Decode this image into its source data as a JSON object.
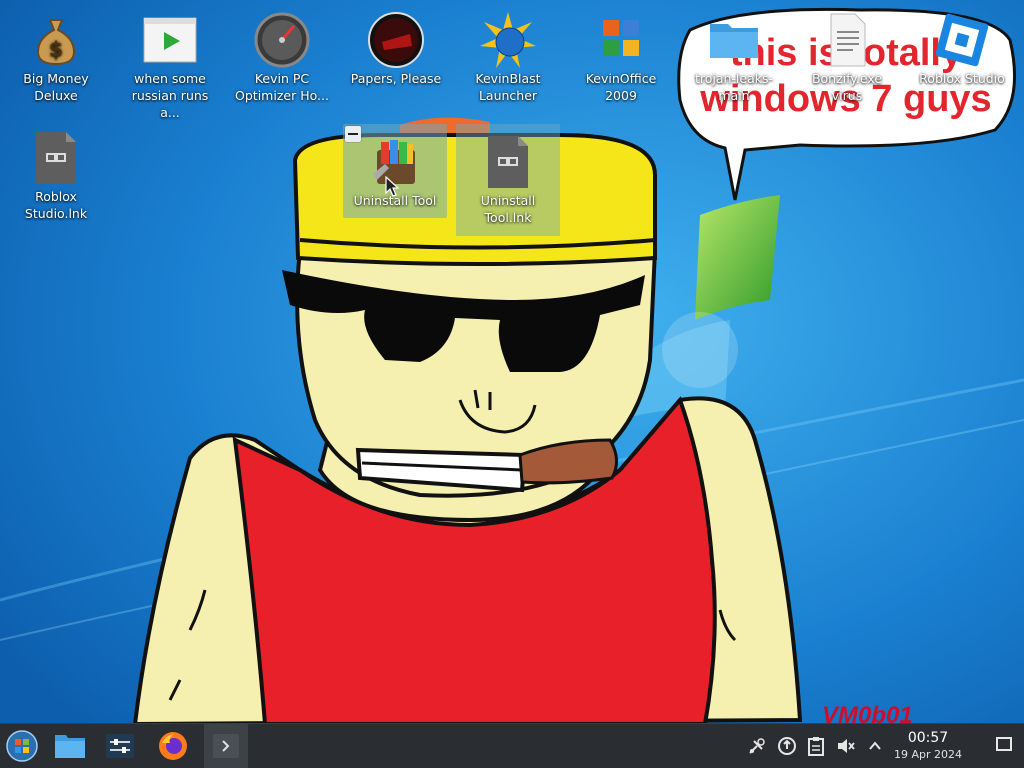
{
  "desktop": {
    "icons": [
      {
        "label": "Big Money Deluxe",
        "icon": "money-bag-icon"
      },
      {
        "label": "when some russian runs a...",
        "icon": "video-file-icon"
      },
      {
        "label": "Kevin PC Optimizer Ho...",
        "icon": "speedometer-icon"
      },
      {
        "label": "Papers, Please",
        "icon": "papers-please-icon"
      },
      {
        "label": "KevinBlast Launcher",
        "icon": "globe-burst-icon"
      },
      {
        "label": "KevinOffice 2009",
        "icon": "office-logo-icon"
      },
      {
        "label": "trojan-leaks-main",
        "icon": "folder-icon"
      },
      {
        "label": "Bonzify.exe virus",
        "icon": "text-file-icon"
      },
      {
        "label": "Roblox Studio",
        "icon": "roblox-studio-icon"
      },
      {
        "label": "Roblox Studio.lnk",
        "icon": "link-file-icon"
      },
      {
        "label": "Uninstall Tool",
        "icon": "uninstall-tool-icon"
      },
      {
        "label": "Uninstall Tool.lnk",
        "icon": "link-file-icon"
      }
    ]
  },
  "wallpaper": {
    "speech_bubble_text": "this is totally windows 7 guys",
    "signature": "VM0b01",
    "colors": {
      "sky": "#1e8fd8",
      "shirt": "#e8202a",
      "skin": "#f6f0b0",
      "hat": "#f5e619",
      "text_red": "#e3262e"
    }
  },
  "taskbar": {
    "launchers": [
      {
        "name": "start-menu",
        "icon": "windows-orb-icon"
      },
      {
        "name": "file-manager",
        "icon": "folder-icon"
      },
      {
        "name": "system-settings",
        "icon": "settings-sliders-icon"
      },
      {
        "name": "firefox",
        "icon": "firefox-icon"
      },
      {
        "name": "terminal",
        "icon": "terminal-icon"
      }
    ],
    "tray": [
      "network-tool-icon",
      "updates-icon",
      "clipboard-icon",
      "volume-muted-icon",
      "expand-tray-icon"
    ],
    "clock": {
      "time": "00:57",
      "date": "19 Apr 2024"
    }
  }
}
